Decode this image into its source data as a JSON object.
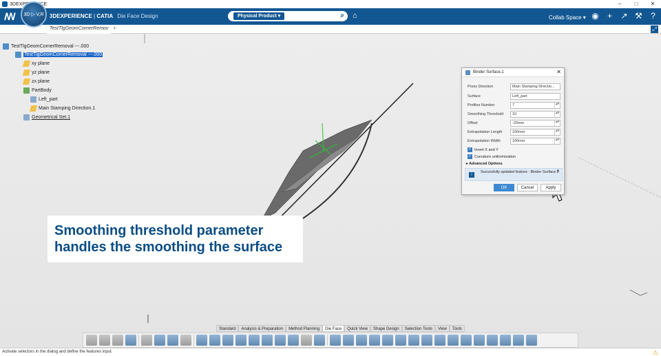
{
  "window": {
    "title": "3DEXPERIENCE"
  },
  "topbar": {
    "compass_label": "3D ▷ V,R",
    "brand_name": "3DEXPERIENCE",
    "brand_product": "CATIA",
    "app_name": "Die Face Design",
    "search_scope": "Physical Product ▾",
    "search_placeholder": "",
    "collab_space": "Collab Space ▾"
  },
  "tabs": [
    {
      "label": "TestTlgGeomCornerRemov"
    }
  ],
  "tree": {
    "root": "TestTlgGeomCornerRemoval ---.000",
    "selected": "TestTlgGeomCornerRemoval ---.000",
    "items": [
      "xy plane",
      "yz plane",
      "zx plane",
      "PartBody",
      "Left_part",
      "Main Stamping Direction.1",
      "Geometrical Set.1"
    ]
  },
  "dialog": {
    "title": "Binder Surface.1",
    "fields": [
      {
        "label": "Press Direction",
        "value": "Main Stamping Directio..."
      },
      {
        "label": "Surface",
        "value": "Left_part"
      },
      {
        "label": "Profiles Number",
        "value": "7"
      },
      {
        "label": "Smoothing Threshold",
        "value": "10"
      },
      {
        "label": "Offset",
        "value": "-20mm"
      },
      {
        "label": "Extrapolation Length",
        "value": "100mm"
      },
      {
        "label": "Extrapolation Width",
        "value": "100mm"
      }
    ],
    "checks": [
      {
        "label": "Invert X and Y",
        "checked": true
      },
      {
        "label": "Curvature uniformization",
        "checked": true
      }
    ],
    "advanced": "Advanced Options",
    "info": "Succesfully updated feature : Binder Surface.1",
    "ok": "OK",
    "cancel": "Cancel",
    "apply": "Apply"
  },
  "caption": {
    "line1": "Smoothing threshold parameter",
    "line2": "handles the smoothing the surface"
  },
  "command_tabs": [
    "Standard",
    "Analysis & Preparation",
    "Method Planning",
    "Die Face",
    "Quick View",
    "Shape Design",
    "Selection Tools",
    "View",
    "Tools"
  ],
  "status": {
    "message": "Activate selectors in the dialog and define the features input."
  }
}
